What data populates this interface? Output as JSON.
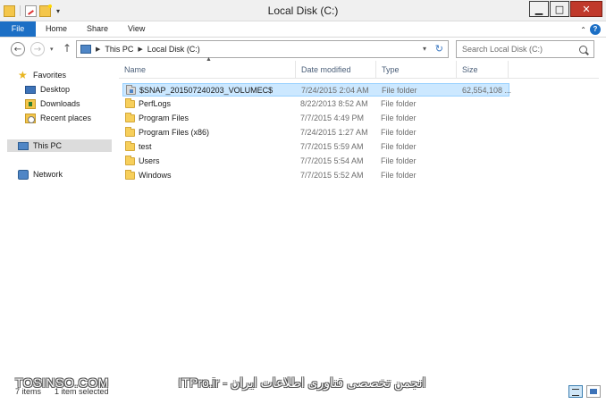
{
  "window": {
    "title": "Local Disk (C:)"
  },
  "quick_access": {
    "dropdown_glyph": "▾"
  },
  "window_controls": {
    "minimize": "▁",
    "maximize": "□",
    "close": "✕"
  },
  "ribbon": {
    "tabs": [
      {
        "label": "File"
      },
      {
        "label": "Home"
      },
      {
        "label": "Share"
      },
      {
        "label": "View"
      }
    ],
    "collapse_glyph": "⌃",
    "help_glyph": "?"
  },
  "navigation": {
    "back_glyph": "←",
    "forward_glyph": "→",
    "recent_glyph": "▾",
    "up_glyph": "↑"
  },
  "address_bar": {
    "crumb_separator": "▶",
    "breadcrumbs": [
      "This PC",
      "Local Disk (C:)"
    ],
    "dropdown_glyph": "▾",
    "refresh_glyph": "↻"
  },
  "search": {
    "placeholder": "Search Local Disk (C:)"
  },
  "nav_pane": {
    "favorites_label": "Favorites",
    "favorites": [
      "Desktop",
      "Downloads",
      "Recent places"
    ],
    "this_pc_label": "This PC",
    "network_label": "Network"
  },
  "columns": {
    "name": "Name",
    "date_modified": "Date modified",
    "type": "Type",
    "size": "Size",
    "sort_glyph": "▲"
  },
  "files": [
    {
      "name": "$SNAP_201507240203_VOLUMEC$",
      "date": "7/24/2015 2:04 AM",
      "type": "File folder",
      "size": "62,554,108 ...",
      "selected": true
    },
    {
      "name": "PerfLogs",
      "date": "8/22/2013 8:52 AM",
      "type": "File folder",
      "size": ""
    },
    {
      "name": "Program Files",
      "date": "7/7/2015 4:49 PM",
      "type": "File folder",
      "size": ""
    },
    {
      "name": "Program Files (x86)",
      "date": "7/24/2015 1:27 AM",
      "type": "File folder",
      "size": ""
    },
    {
      "name": "test",
      "date": "7/7/2015 5:59 AM",
      "type": "File folder",
      "size": ""
    },
    {
      "name": "Users",
      "date": "7/7/2015 5:54 AM",
      "type": "File folder",
      "size": ""
    },
    {
      "name": "Windows",
      "date": "7/7/2015 5:52 AM",
      "type": "File folder",
      "size": ""
    }
  ],
  "status": {
    "item_count": "7 items",
    "selected": "1 item selected"
  },
  "watermark": {
    "left": "TOSINSO.COM",
    "center": "ITPro.ir - انجمن تخصصی فناوری اطلاعات ایران"
  },
  "colors": {
    "file_tab": "#1c6fc5",
    "selection_fill": "#cce8ff",
    "selection_border": "#99d1ff",
    "folder": "#f7cf5b",
    "header_text": "#4c607a"
  }
}
